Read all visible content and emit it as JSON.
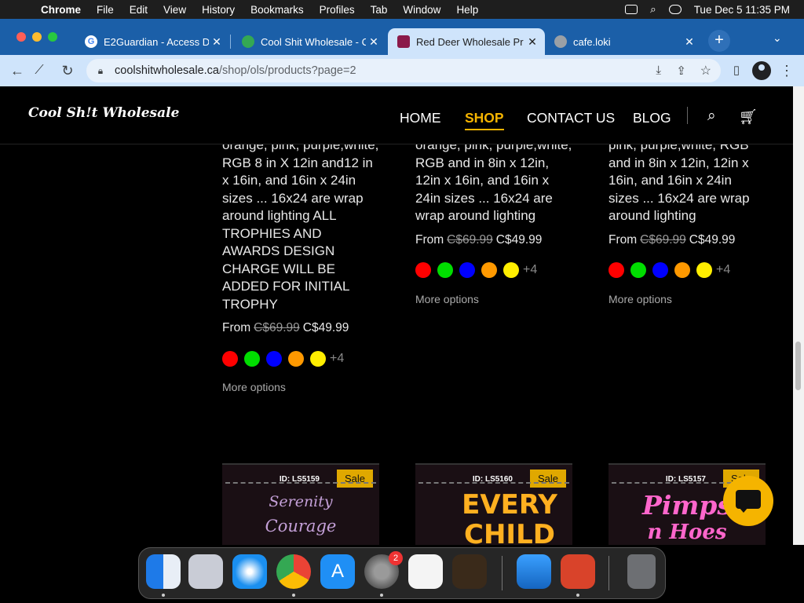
{
  "menubar": {
    "app": "Chrome",
    "items": [
      "File",
      "Edit",
      "View",
      "History",
      "Bookmarks",
      "Profiles",
      "Tab",
      "Window",
      "Help"
    ],
    "clock": "Tue Dec 5  11:35 PM"
  },
  "tabs": [
    {
      "title": "E2Guardian - Access D",
      "favicon_color": "#4285f4"
    },
    {
      "title": "Cool Shit Wholesale - C",
      "favicon_color": "#34a853"
    },
    {
      "title": "Red Deer Wholesale Pr",
      "favicon_color": "#8b1a4a"
    },
    {
      "title": "cafe.loki",
      "favicon_color": "#9aa0a6"
    }
  ],
  "address": {
    "domain": "coolshitwholesale.ca",
    "path": "/shop/ols/products?page=2"
  },
  "site": {
    "logo": "Cool Sh!t Wholesale",
    "nav": [
      "HOME",
      "SHOP",
      "CONTACT US",
      "BLOG"
    ],
    "active_nav": "SHOP",
    "accent": "#f5b400"
  },
  "products": [
    {
      "desc": "orange, pink, purple,white, RGB 8 in X 12in and12 in x 16in, and 16in x 24in sizes ... 16x24 are wrap around lighting ALL TROPHIES AND AWARDS DESIGN CHARGE WILL BE ADDED FOR INITIAL TROPHY",
      "price_prefix": "From",
      "old_price": "C$69.99",
      "price": "C$49.99",
      "more_colors": "+4",
      "more_options": "More options"
    },
    {
      "desc": "orange, pink, purple,white, RGB and in 8in x 12in, 12in x 16in, and 16in x 24in sizes ... 16x24 are wrap around lighting",
      "price_prefix": "From",
      "old_price": "C$69.99",
      "price": "C$49.99",
      "more_colors": "+4",
      "more_options": "More options"
    },
    {
      "desc": "pink, purple,white, RGB and in 8in x 12in, 12in x 16in, and 16in x 24in sizes ... 16x24 are wrap around lighting",
      "price_prefix": "From",
      "old_price": "C$69.99",
      "price": "C$49.99",
      "more_colors": "+4",
      "more_options": "More options"
    }
  ],
  "swatch_colors": [
    "#ff0000",
    "#00dd00",
    "#0000ff",
    "#ff9900",
    "#ffee00"
  ],
  "cards": [
    {
      "id": "ID: LS5159",
      "sale": "Sale",
      "art_line1": "Serenity",
      "art_line2": "Courage",
      "art_color": "#c4a0d8"
    },
    {
      "id": "ID: LS5160",
      "sale": "Sale",
      "art_line1": "EVERY",
      "art_line2": "CHILD",
      "art_color": "#ffb020"
    },
    {
      "id": "ID: LS5157",
      "sale": "Sale",
      "art_line1": "Pimps",
      "art_line2": "n Hoes",
      "art_color": "#ff66cc"
    }
  ],
  "dock": {
    "settings_badge": "2"
  }
}
